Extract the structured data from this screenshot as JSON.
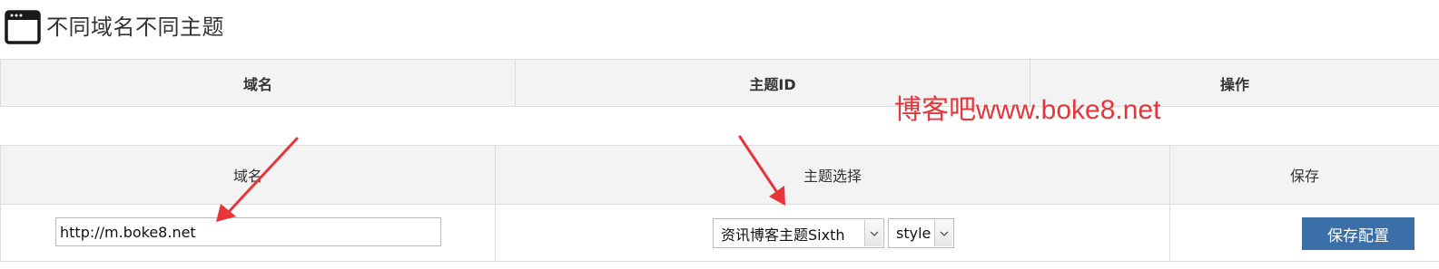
{
  "page": {
    "title": "不同域名不同主题",
    "title_icon": "window-icon"
  },
  "header_table": {
    "columns": [
      "域名",
      "主题ID",
      "操作"
    ]
  },
  "config_table": {
    "columns": [
      "域名",
      "主题选择",
      "保存"
    ],
    "row": {
      "domain_value": "http://m.boke8.net",
      "theme_selected": "资讯博客主题Sixth",
      "style_selected": "style",
      "save_label": "保存配置"
    }
  },
  "watermark": "博客吧www.boke8.net",
  "colors": {
    "accent_button": "#3a6fa8",
    "annotation_red": "#e8353a",
    "header_bg": "#f3f3f3",
    "border": "#dcdcdc"
  }
}
